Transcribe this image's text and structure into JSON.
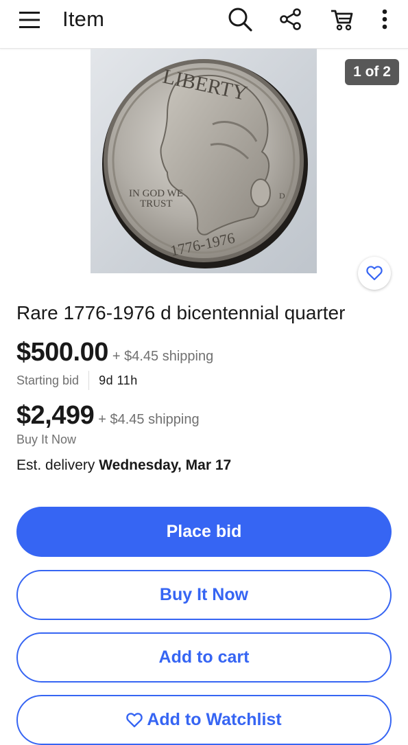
{
  "header": {
    "title": "Item",
    "icons": [
      "menu-icon",
      "search-icon",
      "share-icon",
      "cart-icon",
      "more-icon"
    ]
  },
  "gallery": {
    "counter": "1 of 2",
    "coin_inscriptions": {
      "top": "LIBERTY",
      "motto": [
        "IN GOD WE",
        "TRUST"
      ],
      "years": "1776-1976",
      "mint": "D"
    }
  },
  "listing": {
    "title": "Rare 1776-1976 d bicentennial quarter",
    "auction": {
      "price": "$500.00",
      "shipping": "+ $4.45 shipping",
      "label": "Starting bid",
      "time_left": "9d 11h"
    },
    "buy_now": {
      "price": "$2,499",
      "shipping": "+ $4.45 shipping",
      "label": "Buy It Now"
    },
    "delivery": {
      "prefix": "Est. delivery",
      "date": "Wednesday, Mar 17"
    }
  },
  "actions": {
    "place_bid": "Place bid",
    "buy_it_now": "Buy It Now",
    "add_to_cart": "Add to cart",
    "add_to_watchlist": "Add to Watchlist"
  },
  "colors": {
    "primary": "#3665f3",
    "text": "#191919",
    "secondary_text": "#707070"
  }
}
